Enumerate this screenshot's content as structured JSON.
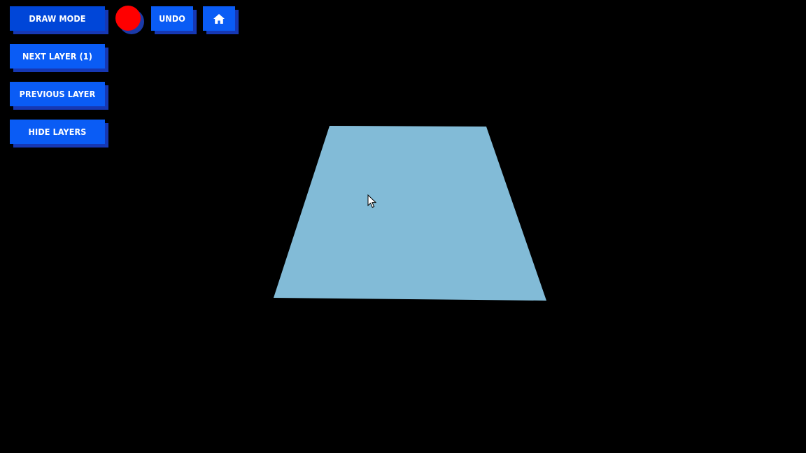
{
  "toolbar": {
    "draw_mode_label": "DRAW MODE",
    "undo_label": "UNDO",
    "next_layer_label": "NEXT LAYER (1)",
    "previous_layer_label": "PREVIOUS LAYER",
    "hide_layers_label": "HIDE LAYERS",
    "home_icon": "home-icon",
    "current_color": "#ff0000"
  },
  "colors": {
    "background": "#000000",
    "button": "#0a5cf5",
    "button_active": "#0046d8",
    "button_shadow": "#1638b4",
    "plane": "#82bbd7"
  },
  "scene": {
    "object": "ground-plane",
    "cursor_icon": "arrow-cursor-icon"
  }
}
